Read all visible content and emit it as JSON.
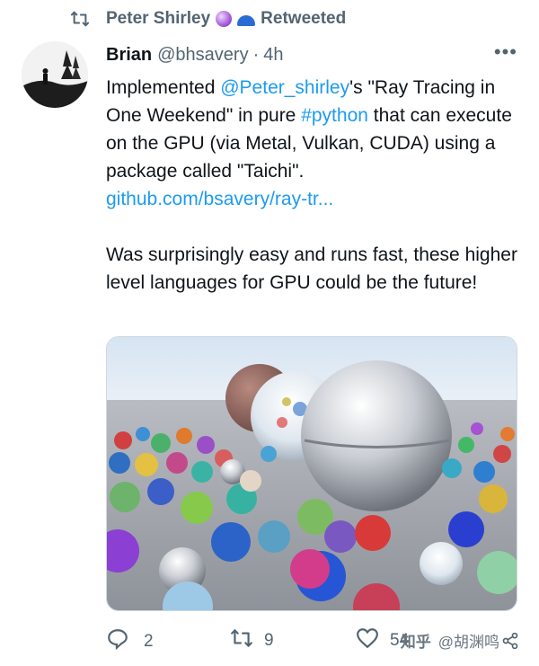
{
  "retweet": {
    "user": "Peter Shirley",
    "label": "Retweeted"
  },
  "tweet": {
    "name": "Brian",
    "handle": "@bhsavery",
    "sep": "·",
    "time": "4h",
    "more": "•••",
    "p1_a": "Implemented ",
    "p1_mention": "@Peter_shirley",
    "p1_b": "'s \"Ray Tracing in One Weekend\" in pure ",
    "p1_hashtag": "#python",
    "p1_c": " that can execute on the GPU (via Metal, Vulkan, CUDA) using a package called \"Taichi\".",
    "link": "github.com/bsavery/ray-tr...",
    "p2": "Was surprisingly easy and runs fast, these higher level languages for GPU could be the future!"
  },
  "actions": {
    "replies": "2",
    "retweets": "9",
    "likes": "54"
  },
  "watermark": {
    "site": "知乎",
    "author": "@胡渊鸣"
  },
  "colors": {
    "link": "#1d9bf0",
    "muted": "#536471",
    "text": "#0f1419"
  },
  "icons": [
    "retweet-icon",
    "crystal-ball-icon",
    "cap-icon",
    "more-icon",
    "reply-icon",
    "like-icon",
    "share-icon"
  ]
}
